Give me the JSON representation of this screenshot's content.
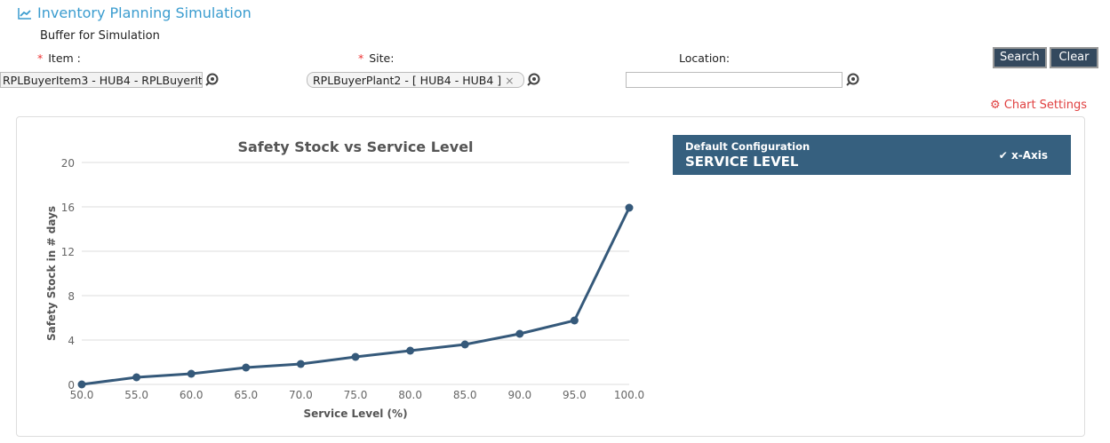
{
  "header": {
    "title": "Inventory Planning Simulation",
    "subtitle": "Buffer for Simulation"
  },
  "form": {
    "required_mark": "*",
    "item_label": "Item :",
    "item_value": "RPLBuyerItem3 - HUB4 - RPLBuyerIt",
    "site_label": "Site:",
    "site_value": "RPLBuyerPlant2 - [ HUB4 - HUB4 ]",
    "site_clear": "×",
    "location_label": "Location:",
    "location_value": "",
    "search_label": "Search",
    "clear_label": "Clear"
  },
  "chart_settings_label": "Chart Settings",
  "config": {
    "heading": "Default Configuration",
    "name": "SERVICE LEVEL",
    "axis": "x-Axis"
  },
  "colors": {
    "accent": "#3a9ccf",
    "series": "#35597a",
    "config_bg": "#36607f"
  },
  "chart_data": {
    "type": "line",
    "title": "Safety Stock vs Service Level",
    "xlabel": "Service Level (%)",
    "ylabel": "Safety Stock in # days",
    "x": [
      "50.0",
      "55.0",
      "60.0",
      "65.0",
      "70.0",
      "75.0",
      "80.0",
      "85.0",
      "90.0",
      "95.0",
      "100.0"
    ],
    "values": [
      0,
      0.64,
      0.96,
      1.52,
      1.84,
      2.48,
      3.04,
      3.6,
      4.56,
      5.76,
      15.92
    ],
    "yticks": [
      "0",
      "4",
      "8",
      "12",
      "16",
      "20"
    ],
    "ylim": [
      0,
      20
    ],
    "grid": true
  }
}
